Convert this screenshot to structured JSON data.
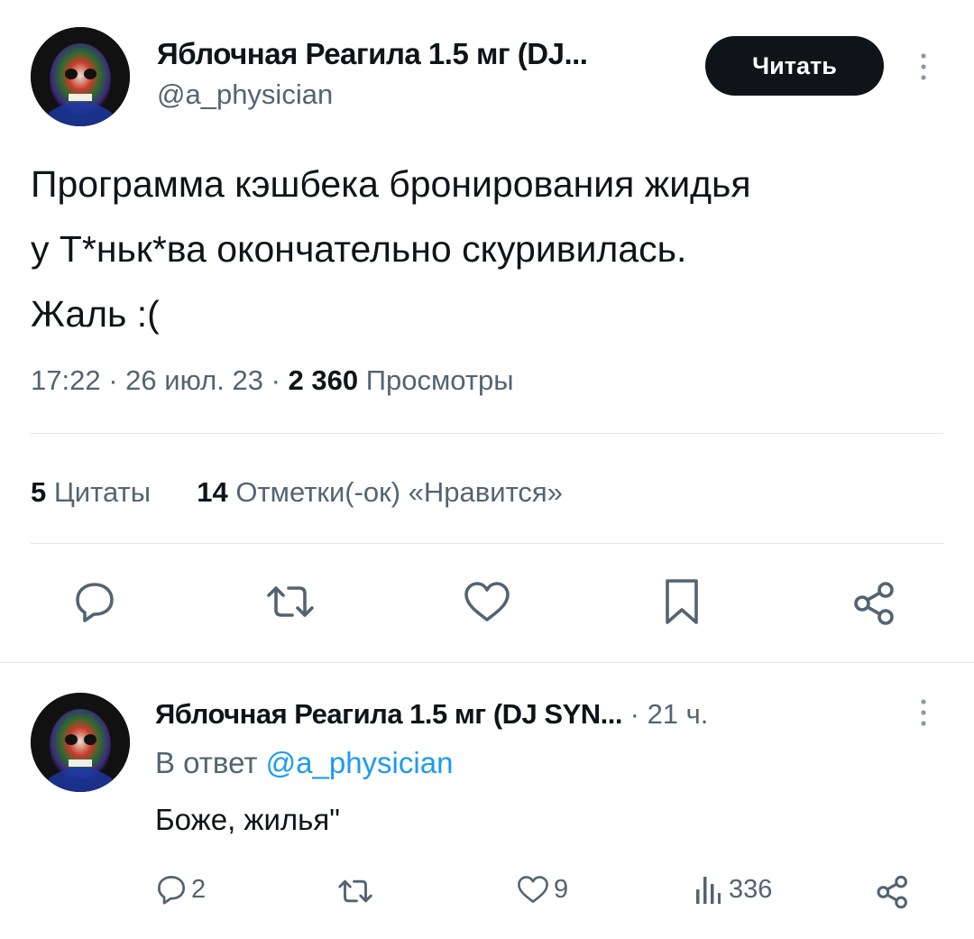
{
  "tweet": {
    "author_name": "Яблочная Реагила 1.5 мг (DJ...",
    "author_handle": "@a_physician",
    "follow_label": "Читать",
    "text_line1": "Программа кэшбека бронирования жидья",
    "text_line2": "у Т*ньк*ва окончательно скуривилась.",
    "text_line3": "Жаль :(",
    "time": "17:22",
    "date": "26 июл. 23",
    "views_count": "2 360",
    "views_label": "Просмотры",
    "quotes_count": "5",
    "quotes_label": "Цитаты",
    "likes_count": "14",
    "likes_label": "Отметки(-ок) «Нравится»",
    "dot": "·"
  },
  "reply": {
    "author_name": "Яблочная Реагила 1.5 мг (DJ SYN...",
    "time_ago": "21 ч.",
    "reply_to_prefix": "В ответ",
    "reply_to_handle": "@a_physician",
    "text": "Боже, жилья\"",
    "replies_count": "2",
    "likes_count": "9",
    "views_count": "336"
  },
  "icons": {
    "reply": "speech-bubble-icon",
    "retweet": "retweet-icon",
    "like": "heart-icon",
    "bookmark": "bookmark-icon",
    "share": "share-icon",
    "views": "bar-chart-icon",
    "more": "more-vertical-icon"
  },
  "colors": {
    "text": "#0f1419",
    "muted": "#536471",
    "link": "#1d9bf0",
    "divider": "#e1e6ea",
    "button": "#0f1419"
  }
}
